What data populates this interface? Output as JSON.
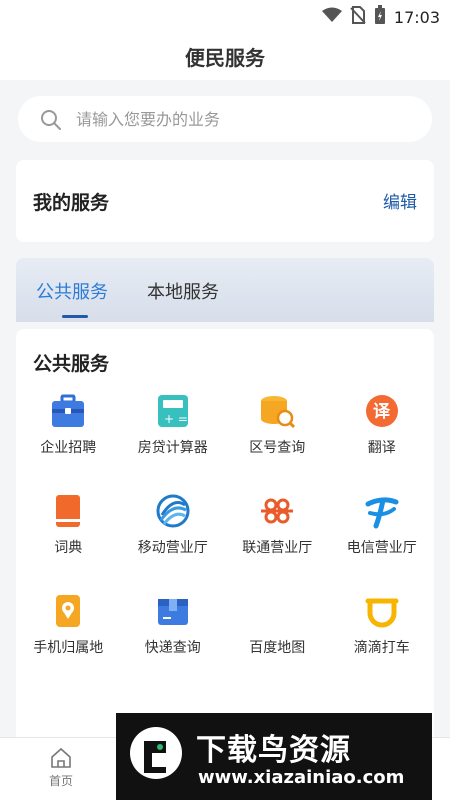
{
  "status_bar": {
    "time": "17:03",
    "icons": [
      "wifi-icon",
      "no-sim-icon",
      "battery-icon"
    ]
  },
  "header": {
    "title": "便民服务"
  },
  "search": {
    "placeholder": "请输入您要办的业务",
    "icon": "search-icon"
  },
  "my_services": {
    "title": "我的服务",
    "edit_label": "编辑"
  },
  "tabs": [
    {
      "label": "公共服务",
      "active": true
    },
    {
      "label": "本地服务",
      "active": false
    }
  ],
  "public_services": {
    "title": "公共服务",
    "items": [
      {
        "label": "企业招聘",
        "icon": "briefcase-icon"
      },
      {
        "label": "房贷计算器",
        "icon": "calculator-icon"
      },
      {
        "label": "区号查询",
        "icon": "database-search-icon"
      },
      {
        "label": "翻译",
        "icon": "translate-icon"
      },
      {
        "label": "词典",
        "icon": "dictionary-icon"
      },
      {
        "label": "移动营业厅",
        "icon": "china-mobile-icon"
      },
      {
        "label": "联通营业厅",
        "icon": "china-unicom-icon"
      },
      {
        "label": "电信营业厅",
        "icon": "china-telecom-icon"
      },
      {
        "label": "手机归属地",
        "icon": "phone-location-icon"
      },
      {
        "label": "快递查询",
        "icon": "package-icon"
      },
      {
        "label": "百度地图",
        "icon": "map-icon"
      },
      {
        "label": "滴滴打车",
        "icon": "didi-icon"
      }
    ]
  },
  "bottom_nav": {
    "home_label": "首页"
  },
  "banner": {
    "name": "下载鸟资源",
    "url": "www.xiazainiao.com"
  },
  "colors": {
    "accent": "#2e7bd6",
    "edit": "#1e5aa8",
    "background": "#f4f5f7"
  }
}
